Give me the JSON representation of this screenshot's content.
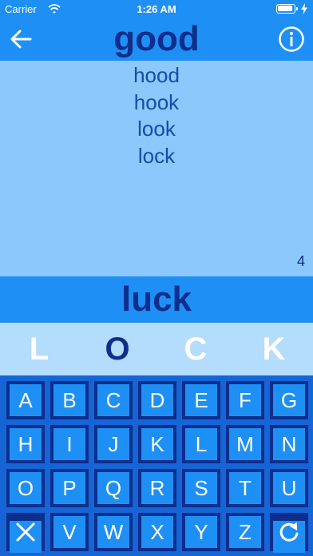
{
  "status_bar": {
    "carrier": "Carrier",
    "time": "1:26 AM"
  },
  "nav": {
    "target_word": "good"
  },
  "history": {
    "words": [
      "hood",
      "hook",
      "look",
      "lock"
    ],
    "count": "4"
  },
  "current_word": "luck",
  "letters": [
    {
      "char": "L",
      "changed": false
    },
    {
      "char": "O",
      "changed": true
    },
    {
      "char": "C",
      "changed": false
    },
    {
      "char": "K",
      "changed": false
    }
  ],
  "keyboard": {
    "rows": [
      [
        "A",
        "B",
        "C",
        "D",
        "E",
        "F",
        "G"
      ],
      [
        "H",
        "I",
        "J",
        "K",
        "L",
        "M",
        "N"
      ],
      [
        "O",
        "P",
        "Q",
        "R",
        "S",
        "T",
        "U"
      ],
      [
        "clear",
        "V",
        "W",
        "X",
        "Y",
        "Z",
        "restart"
      ]
    ],
    "clear_icon": "close-x-icon",
    "restart_icon": "restart-icon"
  },
  "colors": {
    "header": "#1e90f5",
    "history_bg": "#8cc8fc",
    "letters_bg": "#b4dcfd",
    "keyboard_bg": "#1565d6",
    "key_border": "#0d2e8c",
    "key_face": "#1e90f5",
    "dark_text": "#0d2e8c",
    "history_text": "#1a4aaa"
  }
}
